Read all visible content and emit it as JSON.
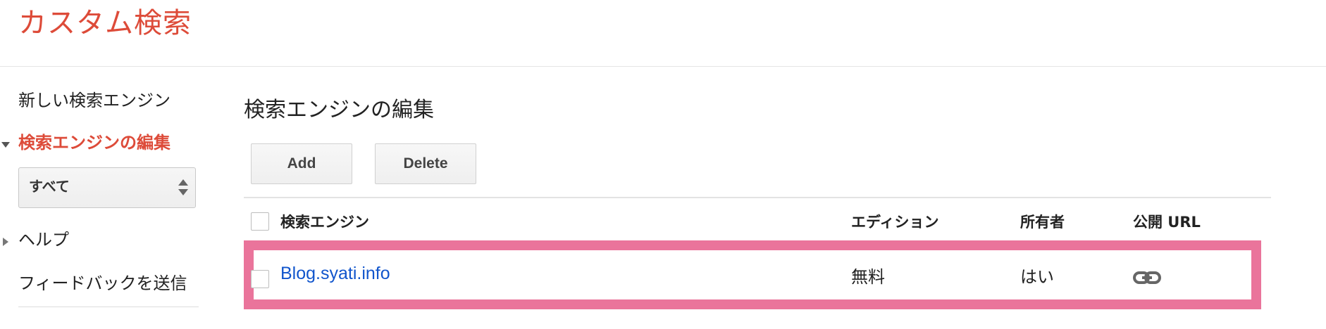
{
  "header": {
    "title": "カスタム検索"
  },
  "sidebar": {
    "items": [
      {
        "label": "新しい検索エンジン"
      },
      {
        "label": "検索エンジンの編集",
        "active": true
      },
      {
        "label": "ヘルプ"
      },
      {
        "label": "フィードバックを送信"
      }
    ],
    "filter": {
      "value": "すべて",
      "icon": "up-down-arrows-icon"
    }
  },
  "main": {
    "title": "検索エンジンの編集",
    "buttons": {
      "add": "Add",
      "delete": "Delete"
    },
    "table": {
      "columns": [
        "検索エンジン",
        "エディション",
        "所有者",
        "公開 URL"
      ],
      "rows": [
        {
          "name": "Blog.syati.info",
          "edition": "無料",
          "owner": "はい",
          "public_url_icon": "link-icon"
        }
      ]
    }
  },
  "colors": {
    "brand": "#dd4b39",
    "link": "#1155cc",
    "highlight": "#ea749b"
  }
}
